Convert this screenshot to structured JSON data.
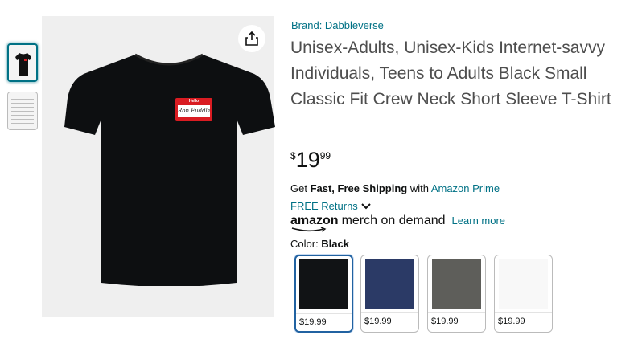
{
  "product": {
    "brand_link": "Brand: Dabbleverse",
    "title": "Unisex-Adults, Unisex-Kids Internet-savvy Individuals, Teens to Adults Black Small Classic Fit Crew Neck Short Sleeve T-Shirt",
    "price": {
      "symbol": "$",
      "whole": "19",
      "fraction": "99"
    },
    "shipping": {
      "prefix": "Get ",
      "bold": "Fast, Free Shipping",
      "middle": " with ",
      "link": "Amazon Prime"
    },
    "returns_label": "FREE Returns",
    "merch": {
      "logo": "amazon",
      "tagline": "merch on demand",
      "learn_more": "Learn more"
    },
    "color": {
      "label": "Color: ",
      "value": "Black"
    },
    "swatches": [
      {
        "name": "Black",
        "color": "#111315",
        "price": "$19.99",
        "selected": true
      },
      {
        "name": "Navy",
        "color": "#2b3a66",
        "price": "$19.99",
        "selected": false
      },
      {
        "name": "Gray",
        "color": "#5e5e5a",
        "price": "$19.99",
        "selected": false
      },
      {
        "name": "White",
        "color": "#f8f8f8",
        "price": "$19.99",
        "selected": false
      }
    ]
  },
  "image": {
    "name_tag_header": "Hello",
    "name_tag_text": "Ron Fuddle",
    "shirt_color": "#0d0f11"
  },
  "icons": {
    "share": "share-icon",
    "returns_dropdown": "chevron-down-icon"
  },
  "colors": {
    "link": "#007185",
    "selected_swatch_border": "#2162a1",
    "tag_red": "#d91c22"
  }
}
